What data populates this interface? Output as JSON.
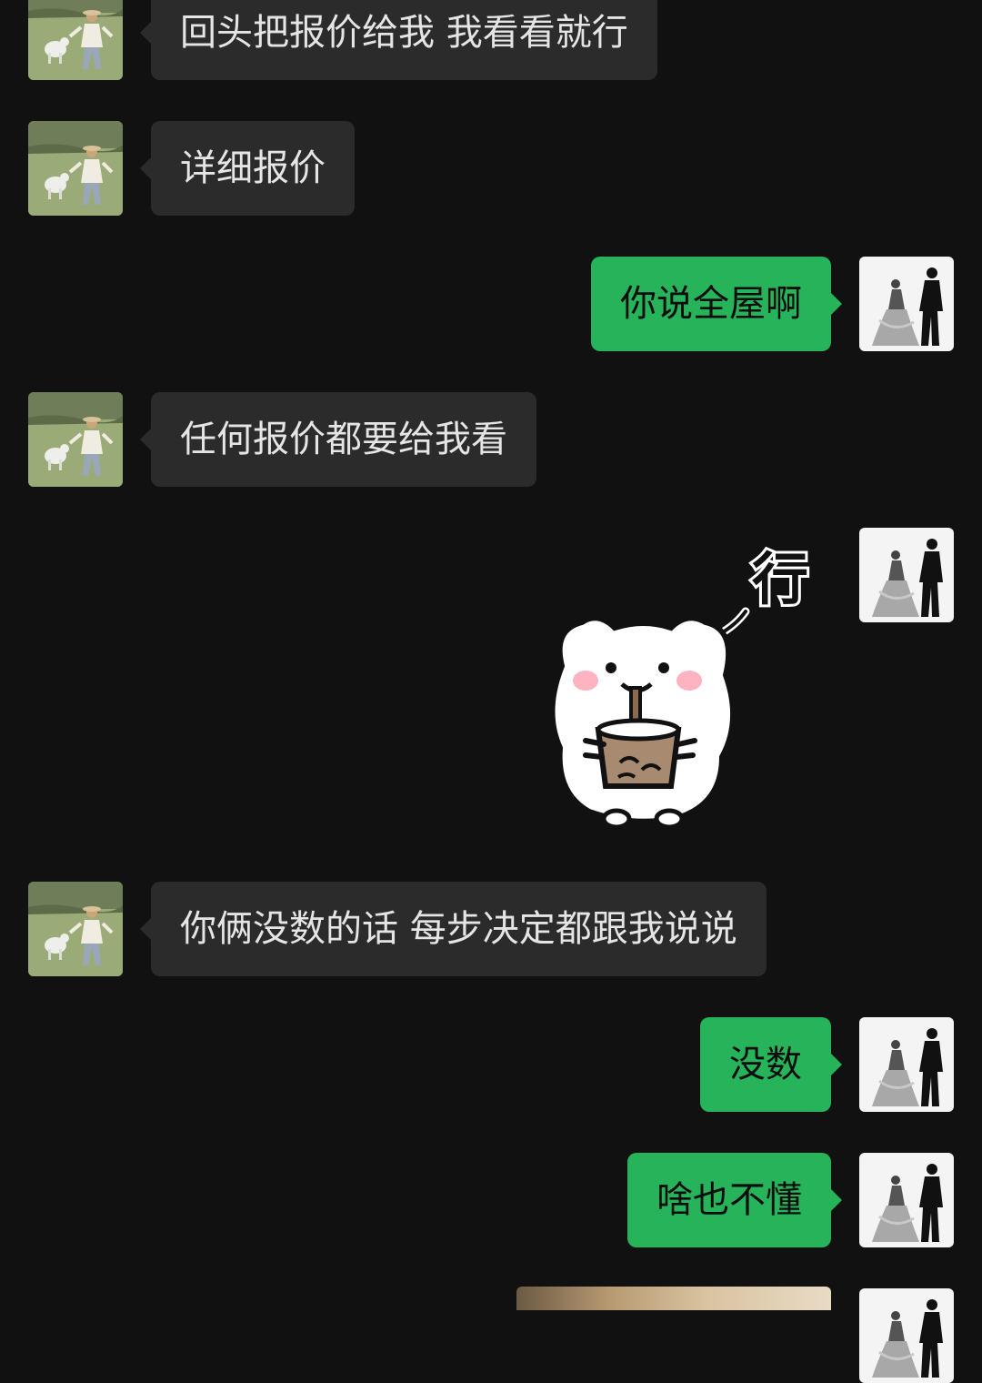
{
  "messages": [
    {
      "side": "in",
      "text": "回头把报价给我  我看看就行"
    },
    {
      "side": "in",
      "text": "详细报价"
    },
    {
      "side": "out",
      "text": "你说全屋啊"
    },
    {
      "side": "in",
      "text": "任何报价都要给我看"
    },
    {
      "side": "out",
      "type": "sticker",
      "sticker_text": "行"
    },
    {
      "side": "in",
      "text": "你俩没数的话  每步决定都跟我说说"
    },
    {
      "side": "out",
      "text": "没数"
    },
    {
      "side": "out",
      "text": "啥也不懂"
    },
    {
      "side": "out",
      "type": "image"
    }
  ],
  "colors": {
    "background": "#111111",
    "incoming_bubble": "#2b2b2b",
    "outgoing_bubble": "#27b35a"
  },
  "icons": {
    "incoming_avatar": "avatar-icon-person-with-dog",
    "outgoing_avatar": "avatar-icon-couple-silhouette"
  }
}
